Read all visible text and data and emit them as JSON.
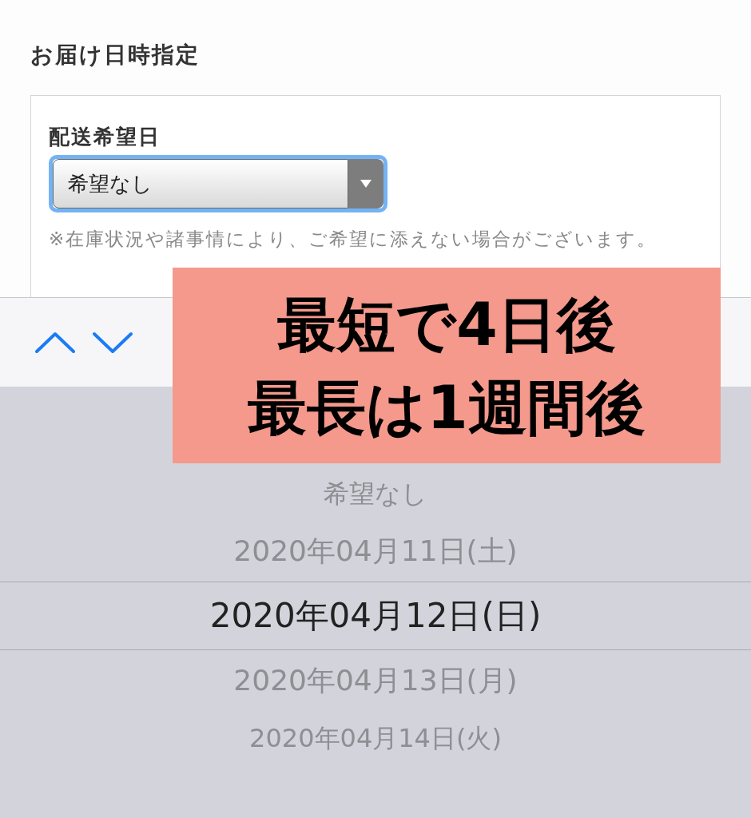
{
  "section_title": "お届け日時指定",
  "field": {
    "label": "配送希望日",
    "value": "希望なし",
    "note": "※在庫状況や諸事情により、ご希望に添えない場合がございます。"
  },
  "picker": {
    "items": [
      {
        "label": "希望なし",
        "selected": false
      },
      {
        "label": "2020年04月11日(土)",
        "selected": false
      },
      {
        "label": "2020年04月12日(日)",
        "selected": true
      },
      {
        "label": "2020年04月13日(月)",
        "selected": false
      },
      {
        "label": "2020年04月14日(火)",
        "selected": false
      }
    ]
  },
  "annotation": {
    "lines": [
      "最短で4日後",
      "最長は1週間後"
    ]
  }
}
